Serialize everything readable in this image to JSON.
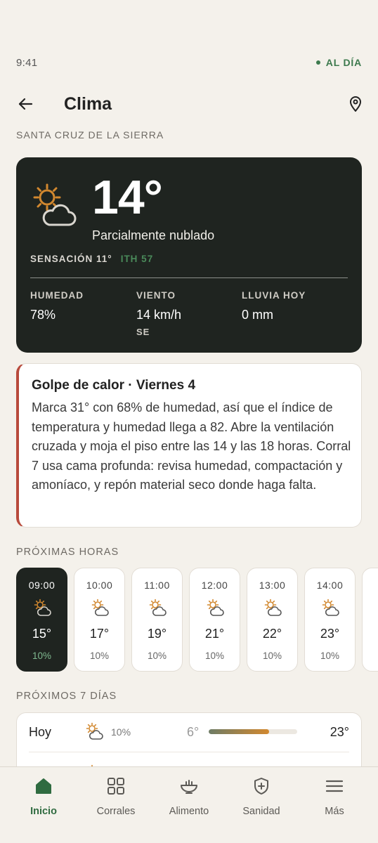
{
  "status_bar": {
    "time": "9:41",
    "sync_status": "AL DÍA"
  },
  "header": {
    "title": "Clima",
    "back_icon": "arrow-left-icon",
    "location_icon": "map-pin-icon"
  },
  "location": "SANTA CRUZ DE LA SIERRA",
  "current": {
    "icon": "partly-cloudy-icon",
    "temperature": "14°",
    "condition": "Parcialmente nublado",
    "feels_like": "SENSACIÓN 11°",
    "ith": "ITH 57",
    "humidity_label": "HUMEDAD",
    "humidity": "78%",
    "wind_label": "VIENTO",
    "wind": "14 km/h",
    "wind_direction": "SE",
    "rain_label": "LLUVIA HOY",
    "rain": "0 mm"
  },
  "alert": {
    "title": "Golpe de calor · Viernes 4",
    "body": "Marca 31° con 68% de humedad, así que el índice de temperatura y humedad llega a 82. Abre la ventilación cruzada y moja el piso entre las 14 y las 18 horas. Corral 7 usa cama profunda: revisa humedad, compactación y amoníaco, y repón material seco donde haga falta.",
    "accent_color": "#b84a3c"
  },
  "hourly_label": "PRÓXIMAS HORAS",
  "hourly": [
    {
      "time": "09:00",
      "temp": "15°",
      "rain": "10%",
      "icon": "partly-cloudy-icon",
      "active": true
    },
    {
      "time": "10:00",
      "temp": "17°",
      "rain": "10%",
      "icon": "partly-cloudy-icon"
    },
    {
      "time": "11:00",
      "temp": "19°",
      "rain": "10%",
      "icon": "partly-cloudy-icon"
    },
    {
      "time": "12:00",
      "temp": "21°",
      "rain": "10%",
      "icon": "partly-cloudy-icon"
    },
    {
      "time": "13:00",
      "temp": "22°",
      "rain": "10%",
      "icon": "partly-cloudy-icon"
    },
    {
      "time": "14:00",
      "temp": "23°",
      "rain": "10%",
      "icon": "partly-cloudy-icon"
    }
  ],
  "daily_label": "PRÓXIMOS 7 DÍAS",
  "daily": [
    {
      "day": "Hoy",
      "rain": "10%",
      "low": "6°",
      "high": "23°",
      "range_start": 0.0,
      "range_end": 0.68,
      "icon": "partly-cloudy-icon"
    }
  ],
  "nav": [
    {
      "label": "Inicio",
      "icon": "home-icon",
      "active": true
    },
    {
      "label": "Corrales",
      "icon": "grid-icon"
    },
    {
      "label": "Alimento",
      "icon": "feed-bowl-icon"
    },
    {
      "label": "Sanidad",
      "icon": "shield-plus-icon"
    },
    {
      "label": "Más",
      "icon": "menu-icon"
    }
  ],
  "colors": {
    "accent_green": "#2f6b40",
    "card_dark": "#1f2420",
    "sun": "#d2882f",
    "background": "#f4f1eb"
  }
}
